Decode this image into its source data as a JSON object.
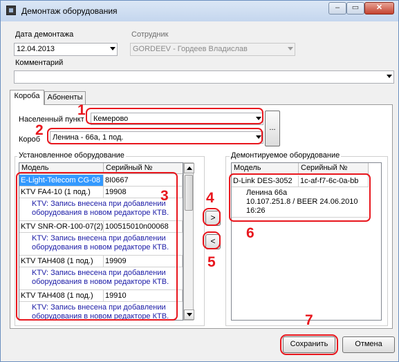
{
  "window": {
    "title": "Демонтаж оборудования",
    "minimize_glyph": "–",
    "maximize_glyph": "▭",
    "close_glyph": "✕"
  },
  "header": {
    "date_label": "Дата демонтажа",
    "date_value": "12.04.2013",
    "employee_label": "Сотрудник",
    "employee_value": "GORDEEV - Гордеев Владислав",
    "comment_label": "Комментарий",
    "comment_value": ""
  },
  "tabs": [
    {
      "label": "Короба",
      "active": true
    },
    {
      "label": "Абоненты",
      "active": false
    }
  ],
  "boxes_tab": {
    "locality_label": "Населенный пункт",
    "locality_value": "Кемерово",
    "box_label": "Короб",
    "box_value": "Ленина - 66а, 1 под.",
    "browse_label": "..."
  },
  "installed": {
    "title": "Установленное оборудование",
    "col_model": "Модель",
    "col_serial": "Серийный №",
    "rows": [
      {
        "model": "E-Light-Telecom CG-08",
        "serial": "8I0667",
        "detail": ""
      },
      {
        "model": "KTV FA4-10 (1 под.)",
        "serial": "19908",
        "detail_line1": "KTV: Запись внесена при добавлении",
        "detail_line2": "оборудования в новом редакторе КТВ."
      },
      {
        "model": "KTV SNR-OR-100-07(2)",
        "serial": "100515010n00068",
        "detail_line1": "KTV: Запись внесена при добавлении",
        "detail_line2": "оборудования в новом редакторе КТВ."
      },
      {
        "model": "KTV TAH408 (1 под.)",
        "serial": "19909",
        "detail_line1": "KTV: Запись внесена при добавлении",
        "detail_line2": "оборудования в новом редакторе КТВ."
      },
      {
        "model": "KTV TAH408 (1 под.)",
        "serial": "19910",
        "detail_line1": "KTV: Запись внесена при добавлении",
        "detail_line2": "оборудования в новом редакторе КТВ."
      }
    ]
  },
  "removed": {
    "title": "Демонтируемое оборудование",
    "col_model": "Модель",
    "col_serial": "Серийный №",
    "rows": [
      {
        "model": "D-Link DES-3052",
        "serial": "1c-af-f7-6c-0a-bb",
        "detail_line1": "Ленина 66а",
        "detail_line2": "10.107.251.8 / BEER 24.06.2010",
        "detail_line3": "16:26"
      }
    ]
  },
  "transfer": {
    "move_right_label": ">",
    "move_left_label": "<"
  },
  "footer": {
    "save_label": "Сохранить",
    "cancel_label": "Отмена"
  },
  "annotations": {
    "color": "#e8161d",
    "n1": "1",
    "n2": "2",
    "n3": "3",
    "n4": "4",
    "n5": "5",
    "n6": "6",
    "n7": "7"
  }
}
